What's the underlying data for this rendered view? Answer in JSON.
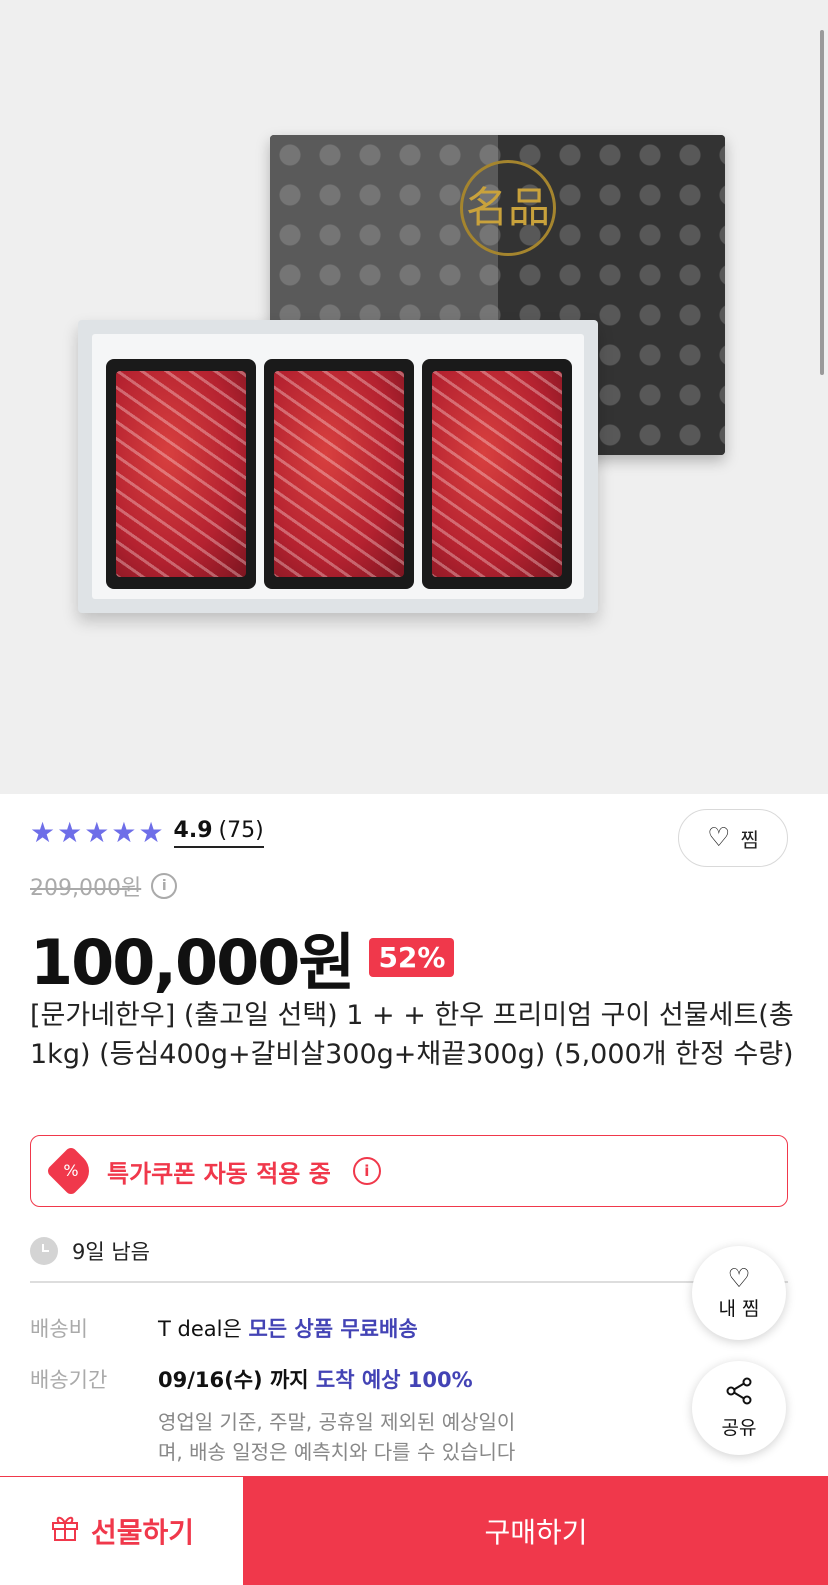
{
  "product_image": {
    "seal_text": "名品",
    "alt": "한우 선물세트 이미지"
  },
  "rating": {
    "stars": 5,
    "score": "4.9",
    "count": "(75)"
  },
  "wish": {
    "label": "찜"
  },
  "price": {
    "original": "209,000원",
    "current": "100,000원",
    "discount": "52%"
  },
  "title": "[문가네한우] (출고일 선택) 1 + + 한우 프리미엄 구이 선물세트(총 1kg) (등심400g+갈비살300g+채끝300g) (5,000개 한정 수량)",
  "coupon": {
    "text": "특가쿠폰 자동 적용 중"
  },
  "remaining": {
    "text": "9일 남음"
  },
  "shipping": {
    "fee_label": "배송비",
    "fee_prefix": "T deal은 ",
    "fee_highlight": "모든 상품 무료배송",
    "period_label": "배송기간",
    "period_date": "09/16(수) 까지 ",
    "period_highlight": "도착 예상 100%",
    "note": "영업일 기준, 주말, 공휴일 제외된 예상일이며, 배송 일정은 예측치와 다를 수 있습니다"
  },
  "floating": {
    "wish_label": "내 찜",
    "share_label": "공유"
  },
  "bottom_bar": {
    "gift_label": "선물하기",
    "buy_label": "구매하기"
  },
  "colors": {
    "accent": "#f0384b",
    "star": "#6e6ee8",
    "highlight": "#4343b5"
  }
}
